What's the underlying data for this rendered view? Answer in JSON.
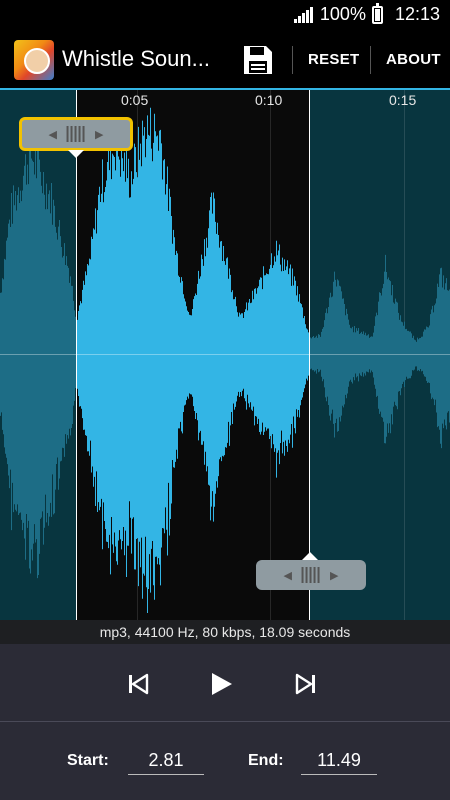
{
  "status": {
    "battery": "100%",
    "time": "12:13"
  },
  "actionbar": {
    "title": "Whistle Soun...",
    "reset_label": "RESET",
    "about_label": "ABOUT"
  },
  "timeline": {
    "ticks": [
      "0:05",
      "0:10",
      "0:15"
    ]
  },
  "file_info": "mp3, 44100 Hz, 80 kbps, 18.09 seconds",
  "footer": {
    "start_label": "Start:",
    "start_value": "2.81",
    "end_label": "End:",
    "end_value": "11.49"
  },
  "colors": {
    "accent": "#33b5e5",
    "wave_selected": "#33b5e5",
    "wave_unselected": "#1d6d86",
    "background_unselected": "#08353f",
    "marker_highlight": "#f2c200"
  },
  "icons": [
    "signal-icon",
    "battery-icon",
    "save-icon",
    "skip-previous-icon",
    "play-icon",
    "skip-next-icon"
  ]
}
